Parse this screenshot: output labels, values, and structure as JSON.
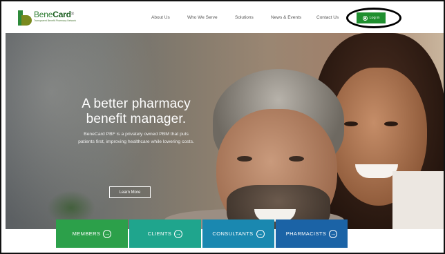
{
  "brand": {
    "name_part1": "Bene",
    "name_part2": "Card",
    "tm": "®",
    "tagline": "Transparent Benefit Pharmacy Network",
    "colors": {
      "primary_green": "#2e8a3a",
      "olive": "#7a8a1f"
    }
  },
  "nav": {
    "items": [
      {
        "label": "About Us"
      },
      {
        "label": "Who We Serve"
      },
      {
        "label": "Solutions"
      },
      {
        "label": "News & Events"
      },
      {
        "label": "Contact Us"
      }
    ],
    "login_label": "Log in",
    "login_icon": "user-circle-icon",
    "login_color": "#1f8f2f"
  },
  "hero": {
    "title_line1": "A better pharmacy",
    "title_line2": "benefit manager.",
    "subtitle_line1": "BeneCard PBF is a privately owned PBM that puts",
    "subtitle_line2": "patients first, improving healthcare while lowering costs.",
    "cta_label": "Learn More"
  },
  "tiles": [
    {
      "label": "MEMBERS",
      "icon": "arrow-right-circle-icon",
      "color": "#2ca04a"
    },
    {
      "label": "CLIENTS",
      "icon": "arrow-right-circle-icon",
      "color": "#1fa58d"
    },
    {
      "label": "CONSULTANTS",
      "icon": "arrow-right-circle-icon",
      "color": "#1a88b0"
    },
    {
      "label": "PHARMACISTS",
      "icon": "arrow-right-circle-icon",
      "color": "#1b63a6"
    }
  ],
  "glyphs": {
    "arrow": "→"
  }
}
